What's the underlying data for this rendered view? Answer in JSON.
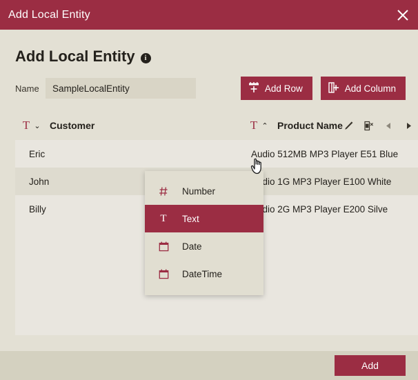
{
  "window": {
    "title": "Add Local Entity",
    "close_label": "×",
    "close_icon": "close-icon"
  },
  "page": {
    "heading": "Add Local Entity",
    "info_glyph": "i",
    "info_icon": "info-icon"
  },
  "form": {
    "name_label": "Name",
    "name_value": "SampleLocalEntity",
    "name_placeholder": "Name"
  },
  "toolbar": {
    "add_row_label": "Add Row",
    "add_row_icon": "add-row-icon",
    "add_column_label": "Add Column",
    "add_column_icon": "add-column-icon"
  },
  "grid": {
    "columns": [
      {
        "title": "Customer",
        "type_glyph": "T",
        "type_icon": "text-type-icon",
        "chevron": "⌄",
        "chevron_icon": "chevron-down-icon"
      },
      {
        "title": "Product Name",
        "type_glyph": "T",
        "type_icon": "text-type-icon",
        "chevron": "⌃",
        "chevron_icon": "chevron-up-icon"
      }
    ],
    "column_actions": [
      {
        "name": "edit-column-icon"
      },
      {
        "name": "delete-column-icon"
      },
      {
        "name": "move-column-left-icon"
      },
      {
        "name": "move-column-right-icon"
      }
    ],
    "rows": [
      {
        "customer": "Eric",
        "product": "Audio 512MB MP3 Player E51 Blue"
      },
      {
        "customer": "John",
        "product": "Audio 1G MP3 Player E100 White"
      },
      {
        "customer": "Billy",
        "product": "Audio 2G MP3 Player E200 Silve"
      }
    ]
  },
  "type_dropdown": {
    "open": true,
    "items": [
      {
        "label": "Number",
        "glyph": "#",
        "icon": "number-type-icon",
        "selected": false
      },
      {
        "label": "Text",
        "glyph": "T",
        "icon": "text-type-icon",
        "selected": true
      },
      {
        "label": "Date",
        "glyph": "",
        "icon": "date-type-icon",
        "selected": false
      },
      {
        "label": "DateTime",
        "glyph": "",
        "icon": "datetime-type-icon",
        "selected": false
      }
    ]
  },
  "footer": {
    "add_label": "Add"
  },
  "colors": {
    "accent": "#9b2d43",
    "background": "#e3e0d4",
    "grid_row_odd": "#e9e6df",
    "grid_row_even": "#dedbcf",
    "footer": "#d4d1c0",
    "text": "#24211c"
  }
}
